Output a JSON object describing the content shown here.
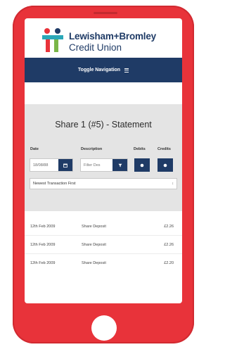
{
  "brand": {
    "name_line1": "Lewisham+Bromley",
    "name_line2": "Credit Union",
    "colors": {
      "navy": "#1f3b66",
      "red": "#e8333a",
      "teal": "#2aa7b8",
      "green": "#7ab648"
    }
  },
  "navbar": {
    "label": "Toggle Navigation",
    "icon": "hamburger-menu-icon"
  },
  "statement": {
    "title": "Share 1 (#5) - Statement",
    "columns": {
      "date": "Date",
      "description": "Description",
      "debits": "Debits",
      "credits": "Credits"
    },
    "date_filter": {
      "value": "18/08/88",
      "icon": "calendar-icon"
    },
    "description_filter": {
      "placeholder": "Filter Des",
      "icon": "filter-icon"
    },
    "debits_button_icon": "sort-icon",
    "credits_button_icon": "sort-icon",
    "sort_select": {
      "value": "Newest Transaction First"
    }
  },
  "transactions": [
    {
      "date": "12th Feb 2009",
      "description": "Share Deposit",
      "amount": "£2.26"
    },
    {
      "date": "12th Feb 2009",
      "description": "Share Deposit",
      "amount": "£2.26"
    },
    {
      "date": "12th Feb 2009",
      "description": "Share Deposit",
      "amount": "£2.20"
    }
  ]
}
